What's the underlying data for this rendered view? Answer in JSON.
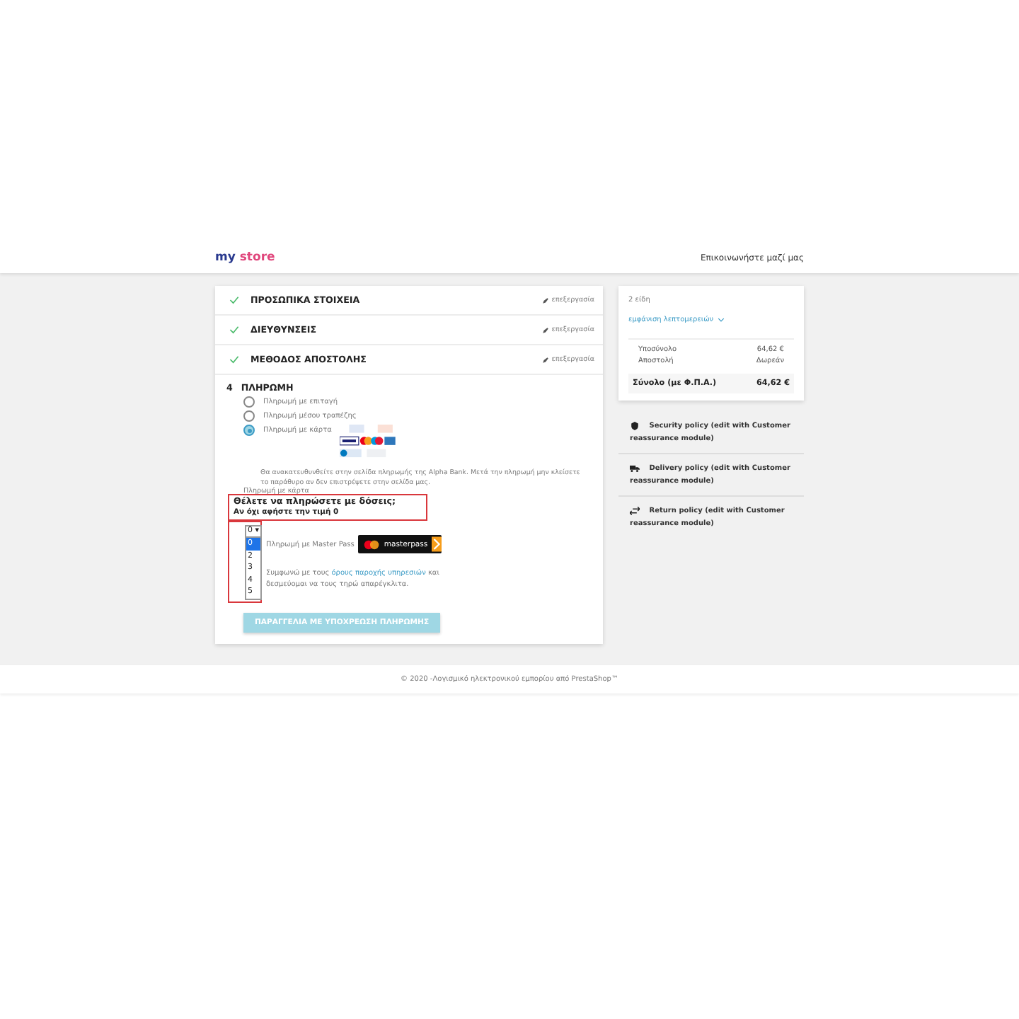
{
  "header": {
    "logo": [
      "my",
      "store"
    ],
    "contact": "Επικοινωνήστε μαζί μας"
  },
  "steps": [
    {
      "title": "ΠΡΟΣΩΠΙΚΑ ΣΤΟΙΧΕΙΑ",
      "edit": "επεξεργασία",
      "done": true
    },
    {
      "title": "ΔΙΕΥΘΥΝΣΕΙΣ",
      "edit": "επεξεργασία",
      "done": true
    },
    {
      "title": "ΜΕΘΟΔΟΣ ΑΠΟΣΤΟΛΗΣ",
      "edit": "επεξεργασία",
      "done": true
    }
  ],
  "payment": {
    "number": "4",
    "title": "ΠΛΗΡΩΜΗ",
    "options": [
      {
        "label": "Πληρωμή με επιταγή",
        "selected": false
      },
      {
        "label": "Πληρωμή μέσου τραπέζης",
        "selected": false
      },
      {
        "label": "Πληρωμή με κάρτα",
        "selected": true,
        "kind": "cards"
      }
    ],
    "redirect_note": "Θα ανακατευθυνθείτε στην σελίδα πληρωμής της Alpha Bank. Μετά την πληρωμή μην κλείσετε το παράθυρο αν δεν επιστρέψετε στην σελίδα μας.",
    "hidden_label": "Πληρωμή με κάρτα",
    "installments": {
      "question": "Θέλετε να πληρώσετε με δόσεις;",
      "hint": "Αν όχι αφήστε την τιμή 0",
      "value": "0",
      "caret": "▾",
      "options": [
        {
          "label": "0",
          "selected": true
        },
        {
          "label": "2",
          "selected": false
        },
        {
          "label": "3",
          "selected": false
        },
        {
          "label": "4",
          "selected": false
        },
        {
          "label": "5",
          "selected": false
        }
      ]
    },
    "masterpass": {
      "label": "Πληρωμή με Master Pass",
      "logo_text": "masterpass"
    },
    "terms": {
      "before": "Συμφωνώ με τους ",
      "link": "όρους παροχής υπηρεσιών",
      "after": " και δεσμεύομαι να τους τηρώ απαρέγκλιτα."
    },
    "submit": {
      "label": "ΠΑΡΑΓΓΕΛΙΑ ΜΕ ΥΠΟΧΡΕΩΣΗ ΠΛΗΡΩΜΗΣ",
      "disabled": true
    }
  },
  "summary": {
    "count": "2 είδη",
    "details_link": "εμφάνιση λεπτομερειών",
    "lines": [
      {
        "label": "Υποσύνολο",
        "value": "64,62 €"
      },
      {
        "label": "Αποστολή",
        "value": "Δωρεάν"
      }
    ],
    "total": {
      "label": "Σύνολο (με Φ.Π.Α.)",
      "value": "64,62 €"
    }
  },
  "reassurance": [
    {
      "kind": "shield",
      "text": "Security policy (edit with Customer reassurance module)"
    },
    {
      "kind": "truck",
      "text": "Delivery policy (edit with Customer reassurance module)"
    },
    {
      "kind": "arrows",
      "text": "Return policy (edit with Customer reassurance module)"
    }
  ],
  "footer": "© 2020 -Λογισμικό ηλεκτρονικού εμπορίου από PrestaShop™"
}
